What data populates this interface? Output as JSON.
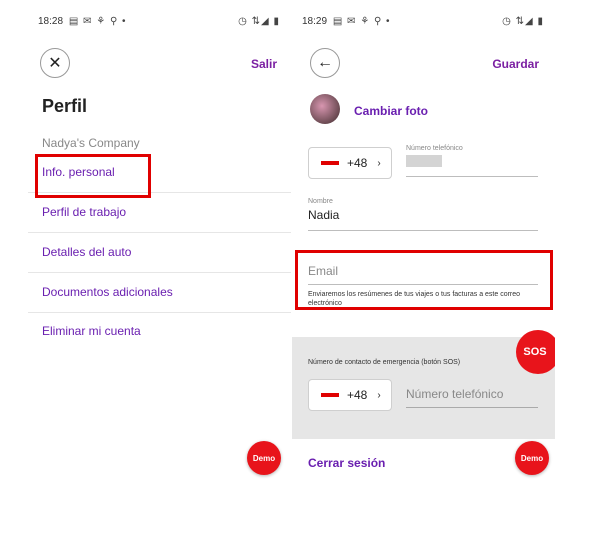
{
  "left_screen": {
    "status_time": "18:28",
    "status_left_icons": "▤ ✉ ⚘ ⚲ •",
    "status_right_icons": "◷ ⇅◢ ▮",
    "close_icon": "close-icon",
    "action_label": "Salir",
    "title": "Perfil",
    "company": "Nadya's Company",
    "menu": [
      {
        "label": "Info. personal"
      },
      {
        "label": "Perfil de trabajo"
      },
      {
        "label": "Detalles del auto"
      },
      {
        "label": "Documentos adicionales"
      },
      {
        "label": "Eliminar mi cuenta"
      }
    ],
    "demo_label": "Demo"
  },
  "right_screen": {
    "status_time": "18:29",
    "status_left_icons": "▤ ✉ ⚘ ⚲ •",
    "status_right_icons": "◷ ⇅◢ ▮",
    "back_icon": "arrow-left-icon",
    "action_label": "Guardar",
    "change_photo_label": "Cambiar foto",
    "phone": {
      "prefix": "+48",
      "label": "Número telefónico"
    },
    "name": {
      "label": "Nombre",
      "value": "Nadia"
    },
    "email": {
      "placeholder": "Email",
      "hint": "Enviaremos los resúmenes de tus viajes o tus facturas a este correo electrónico"
    },
    "emergency": {
      "label": "Número de contacto de emergencia (botón SOS)",
      "prefix": "+48",
      "placeholder": "Número telefónico",
      "sos_label": "SOS"
    },
    "logout_label": "Cerrar sesión",
    "demo_label": "Demo"
  },
  "colors": {
    "accent": "#6a1fb0",
    "brand_red": "#e8141b",
    "highlight_red": "#e00000",
    "panel_gray": "#e6e6e6"
  }
}
